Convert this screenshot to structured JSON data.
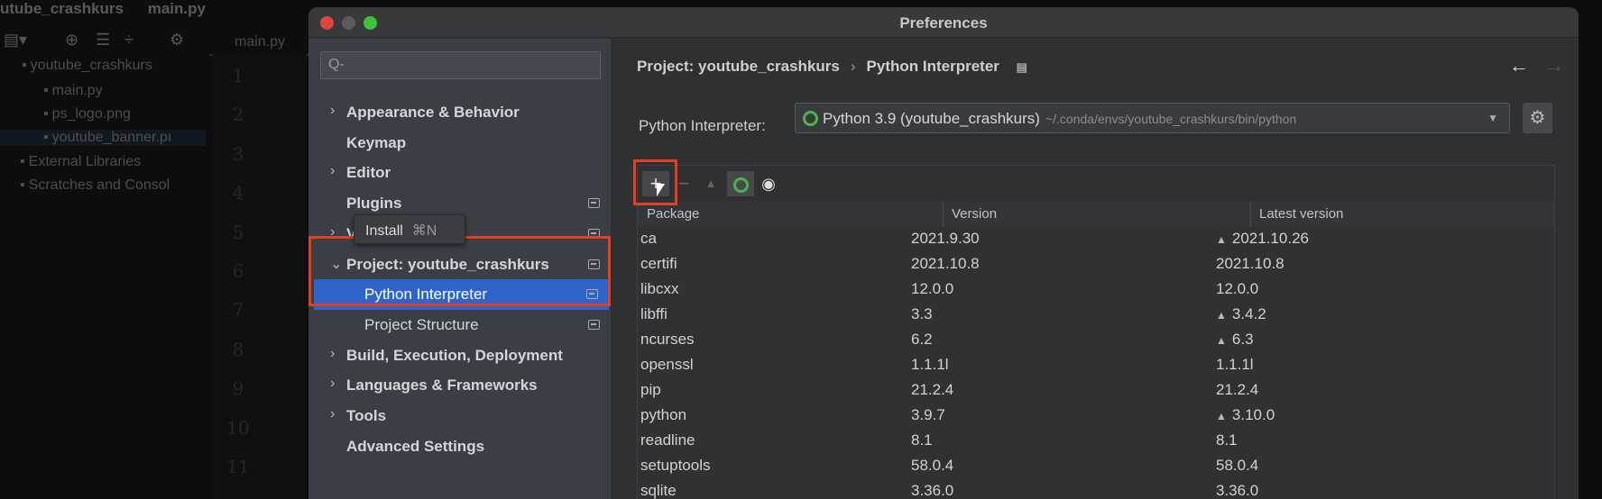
{
  "ide": {
    "title_parts": [
      "utube_crashkurs",
      "main.py"
    ],
    "editor_tab": "main.py",
    "tree": [
      {
        "label": "youtube_crashkurs",
        "icon": "folder-icon"
      },
      {
        "label": "main.py",
        "icon": "python-file-icon"
      },
      {
        "label": "ps_logo.png",
        "icon": "image-file-icon"
      },
      {
        "label": "youtube_banner.pı",
        "icon": "image-file-icon"
      },
      {
        "label": "External Libraries",
        "icon": "library-icon"
      },
      {
        "label": "Scratches and Consol",
        "icon": "scratches-icon"
      }
    ],
    "line_numbers": [
      "1",
      "2",
      "3",
      "4",
      "5",
      "6",
      "7",
      "8",
      "9",
      "10",
      "11"
    ]
  },
  "dialog": {
    "title": "Preferences",
    "search_placeholder": "Q-",
    "sidebar": [
      {
        "label": "Appearance & Behavior",
        "expandable": true
      },
      {
        "label": "Keymap"
      },
      {
        "label": "Editor",
        "expandable": true
      },
      {
        "label": "Plugins",
        "project_icon": true
      },
      {
        "label": "Version Control",
        "expandable": true,
        "project_icon": true
      },
      {
        "label": "Project: youtube_crashkurs",
        "expanded": true,
        "project_icon": true
      },
      {
        "label": "Python Interpreter",
        "selected": true,
        "project_icon": true
      },
      {
        "label": "Project Structure",
        "project_icon": true
      },
      {
        "label": "Build, Execution, Deployment",
        "expandable": true
      },
      {
        "label": "Languages & Frameworks",
        "expandable": true
      },
      {
        "label": "Tools",
        "expandable": true
      },
      {
        "label": "Advanced Settings"
      }
    ],
    "breadcrumb": [
      "Project: youtube_crashkurs",
      "Python Interpreter"
    ],
    "interpreter_label": "Python Interpreter:",
    "interpreter_value": "Python 3.9 (youtube_crashkurs)",
    "interpreter_path": "~/.conda/envs/youtube_crashkurs/bin/python",
    "tooltip": {
      "label": "Install",
      "shortcut": "⌘N"
    },
    "columns": [
      "Package",
      "Version",
      "Latest version"
    ],
    "packages": [
      {
        "name": "ca",
        "version": "2021.9.30",
        "latest": "2021.10.26",
        "upgrade": true
      },
      {
        "name": "certifi",
        "version": "2021.10.8",
        "latest": "2021.10.8",
        "upgrade": false
      },
      {
        "name": "libcxx",
        "version": "12.0.0",
        "latest": "12.0.0",
        "upgrade": false
      },
      {
        "name": "libffi",
        "version": "3.3",
        "latest": "3.4.2",
        "upgrade": true
      },
      {
        "name": "ncurses",
        "version": "6.2",
        "latest": "6.3",
        "upgrade": true
      },
      {
        "name": "openssl",
        "version": "1.1.1l",
        "latest": "1.1.1l",
        "upgrade": false
      },
      {
        "name": "pip",
        "version": "21.2.4",
        "latest": "21.2.4",
        "upgrade": false
      },
      {
        "name": "python",
        "version": "3.9.7",
        "latest": "3.10.0",
        "upgrade": true
      },
      {
        "name": "readline",
        "version": "8.1",
        "latest": "8.1",
        "upgrade": false
      },
      {
        "name": "setuptools",
        "version": "58.0.4",
        "latest": "58.0.4",
        "upgrade": false
      },
      {
        "name": "sqlite",
        "version": "3.36.0",
        "latest": "3.36.0",
        "upgrade": false
      }
    ],
    "colors": {
      "selection": "#2f65ca",
      "highlight_box": "#e2401f",
      "conda_ring": "#4ab34a"
    }
  }
}
